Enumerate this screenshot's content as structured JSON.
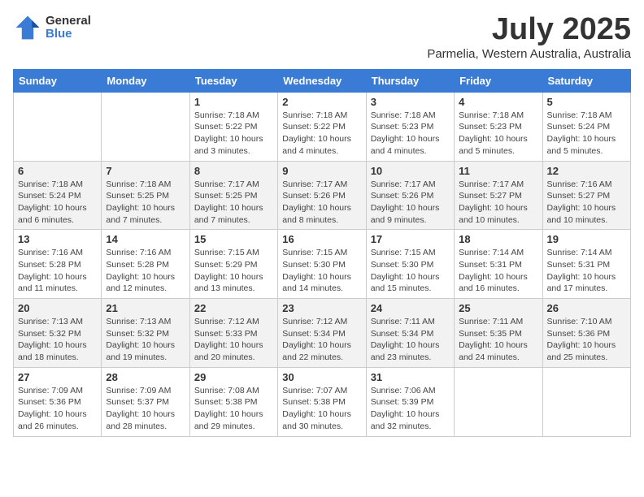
{
  "logo": {
    "general": "General",
    "blue": "Blue"
  },
  "header": {
    "month": "July 2025",
    "location": "Parmelia, Western Australia, Australia"
  },
  "weekdays": [
    "Sunday",
    "Monday",
    "Tuesday",
    "Wednesday",
    "Thursday",
    "Friday",
    "Saturday"
  ],
  "weeks": [
    [
      {
        "day": "",
        "sunrise": "",
        "sunset": "",
        "daylight": ""
      },
      {
        "day": "",
        "sunrise": "",
        "sunset": "",
        "daylight": ""
      },
      {
        "day": "1",
        "sunrise": "Sunrise: 7:18 AM",
        "sunset": "Sunset: 5:22 PM",
        "daylight": "Daylight: 10 hours and 3 minutes."
      },
      {
        "day": "2",
        "sunrise": "Sunrise: 7:18 AM",
        "sunset": "Sunset: 5:22 PM",
        "daylight": "Daylight: 10 hours and 4 minutes."
      },
      {
        "day": "3",
        "sunrise": "Sunrise: 7:18 AM",
        "sunset": "Sunset: 5:23 PM",
        "daylight": "Daylight: 10 hours and 4 minutes."
      },
      {
        "day": "4",
        "sunrise": "Sunrise: 7:18 AM",
        "sunset": "Sunset: 5:23 PM",
        "daylight": "Daylight: 10 hours and 5 minutes."
      },
      {
        "day": "5",
        "sunrise": "Sunrise: 7:18 AM",
        "sunset": "Sunset: 5:24 PM",
        "daylight": "Daylight: 10 hours and 5 minutes."
      }
    ],
    [
      {
        "day": "6",
        "sunrise": "Sunrise: 7:18 AM",
        "sunset": "Sunset: 5:24 PM",
        "daylight": "Daylight: 10 hours and 6 minutes."
      },
      {
        "day": "7",
        "sunrise": "Sunrise: 7:18 AM",
        "sunset": "Sunset: 5:25 PM",
        "daylight": "Daylight: 10 hours and 7 minutes."
      },
      {
        "day": "8",
        "sunrise": "Sunrise: 7:17 AM",
        "sunset": "Sunset: 5:25 PM",
        "daylight": "Daylight: 10 hours and 7 minutes."
      },
      {
        "day": "9",
        "sunrise": "Sunrise: 7:17 AM",
        "sunset": "Sunset: 5:26 PM",
        "daylight": "Daylight: 10 hours and 8 minutes."
      },
      {
        "day": "10",
        "sunrise": "Sunrise: 7:17 AM",
        "sunset": "Sunset: 5:26 PM",
        "daylight": "Daylight: 10 hours and 9 minutes."
      },
      {
        "day": "11",
        "sunrise": "Sunrise: 7:17 AM",
        "sunset": "Sunset: 5:27 PM",
        "daylight": "Daylight: 10 hours and 10 minutes."
      },
      {
        "day": "12",
        "sunrise": "Sunrise: 7:16 AM",
        "sunset": "Sunset: 5:27 PM",
        "daylight": "Daylight: 10 hours and 10 minutes."
      }
    ],
    [
      {
        "day": "13",
        "sunrise": "Sunrise: 7:16 AM",
        "sunset": "Sunset: 5:28 PM",
        "daylight": "Daylight: 10 hours and 11 minutes."
      },
      {
        "day": "14",
        "sunrise": "Sunrise: 7:16 AM",
        "sunset": "Sunset: 5:28 PM",
        "daylight": "Daylight: 10 hours and 12 minutes."
      },
      {
        "day": "15",
        "sunrise": "Sunrise: 7:15 AM",
        "sunset": "Sunset: 5:29 PM",
        "daylight": "Daylight: 10 hours and 13 minutes."
      },
      {
        "day": "16",
        "sunrise": "Sunrise: 7:15 AM",
        "sunset": "Sunset: 5:30 PM",
        "daylight": "Daylight: 10 hours and 14 minutes."
      },
      {
        "day": "17",
        "sunrise": "Sunrise: 7:15 AM",
        "sunset": "Sunset: 5:30 PM",
        "daylight": "Daylight: 10 hours and 15 minutes."
      },
      {
        "day": "18",
        "sunrise": "Sunrise: 7:14 AM",
        "sunset": "Sunset: 5:31 PM",
        "daylight": "Daylight: 10 hours and 16 minutes."
      },
      {
        "day": "19",
        "sunrise": "Sunrise: 7:14 AM",
        "sunset": "Sunset: 5:31 PM",
        "daylight": "Daylight: 10 hours and 17 minutes."
      }
    ],
    [
      {
        "day": "20",
        "sunrise": "Sunrise: 7:13 AM",
        "sunset": "Sunset: 5:32 PM",
        "daylight": "Daylight: 10 hours and 18 minutes."
      },
      {
        "day": "21",
        "sunrise": "Sunrise: 7:13 AM",
        "sunset": "Sunset: 5:32 PM",
        "daylight": "Daylight: 10 hours and 19 minutes."
      },
      {
        "day": "22",
        "sunrise": "Sunrise: 7:12 AM",
        "sunset": "Sunset: 5:33 PM",
        "daylight": "Daylight: 10 hours and 20 minutes."
      },
      {
        "day": "23",
        "sunrise": "Sunrise: 7:12 AM",
        "sunset": "Sunset: 5:34 PM",
        "daylight": "Daylight: 10 hours and 22 minutes."
      },
      {
        "day": "24",
        "sunrise": "Sunrise: 7:11 AM",
        "sunset": "Sunset: 5:34 PM",
        "daylight": "Daylight: 10 hours and 23 minutes."
      },
      {
        "day": "25",
        "sunrise": "Sunrise: 7:11 AM",
        "sunset": "Sunset: 5:35 PM",
        "daylight": "Daylight: 10 hours and 24 minutes."
      },
      {
        "day": "26",
        "sunrise": "Sunrise: 7:10 AM",
        "sunset": "Sunset: 5:36 PM",
        "daylight": "Daylight: 10 hours and 25 minutes."
      }
    ],
    [
      {
        "day": "27",
        "sunrise": "Sunrise: 7:09 AM",
        "sunset": "Sunset: 5:36 PM",
        "daylight": "Daylight: 10 hours and 26 minutes."
      },
      {
        "day": "28",
        "sunrise": "Sunrise: 7:09 AM",
        "sunset": "Sunset: 5:37 PM",
        "daylight": "Daylight: 10 hours and 28 minutes."
      },
      {
        "day": "29",
        "sunrise": "Sunrise: 7:08 AM",
        "sunset": "Sunset: 5:38 PM",
        "daylight": "Daylight: 10 hours and 29 minutes."
      },
      {
        "day": "30",
        "sunrise": "Sunrise: 7:07 AM",
        "sunset": "Sunset: 5:38 PM",
        "daylight": "Daylight: 10 hours and 30 minutes."
      },
      {
        "day": "31",
        "sunrise": "Sunrise: 7:06 AM",
        "sunset": "Sunset: 5:39 PM",
        "daylight": "Daylight: 10 hours and 32 minutes."
      },
      {
        "day": "",
        "sunrise": "",
        "sunset": "",
        "daylight": ""
      },
      {
        "day": "",
        "sunrise": "",
        "sunset": "",
        "daylight": ""
      }
    ]
  ]
}
